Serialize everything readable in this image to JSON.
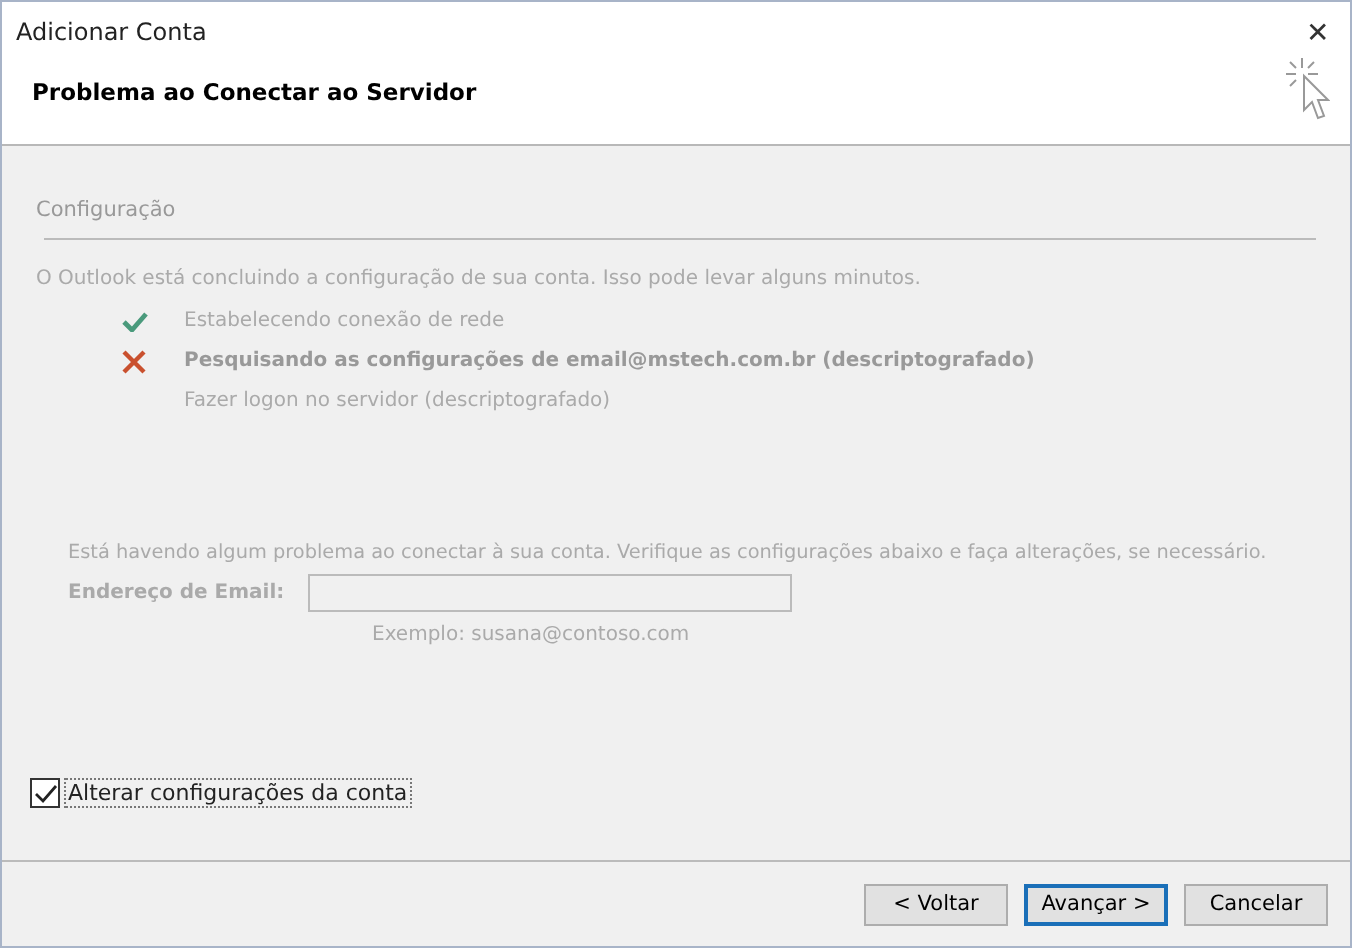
{
  "window": {
    "title": "Adicionar Conta",
    "close": "✕"
  },
  "header": {
    "title": "Problema ao Conectar ao Servidor"
  },
  "section": {
    "title": "Configuração"
  },
  "progress_text": "O Outlook está concluindo a configuração de sua conta. Isso pode levar alguns minutos.",
  "steps": [
    {
      "kind": "done",
      "label": "Estabelecendo conexão de rede"
    },
    {
      "kind": "failed",
      "label": "Pesquisando as configurações de email@mstech.com.br (descriptografado)"
    },
    {
      "kind": "pending",
      "label": "Fazer logon no servidor (descriptografado)"
    }
  ],
  "problem_text": "Está havendo algum problema ao conectar à sua conta. Verifique as configurações abaixo e faça alterações, se necessário.",
  "email": {
    "label": "Endereço de Email:",
    "disabled": true,
    "hint": "Exemplo: susana@contoso.com"
  },
  "change_settings": {
    "label": "Alterar configurações da conta",
    "checked": true
  },
  "buttons": [
    {
      "label": "< Voltar",
      "selected": false
    },
    {
      "label": "Avançar >",
      "selected": true
    },
    {
      "label": "Cancelar",
      "selected": false
    }
  ]
}
